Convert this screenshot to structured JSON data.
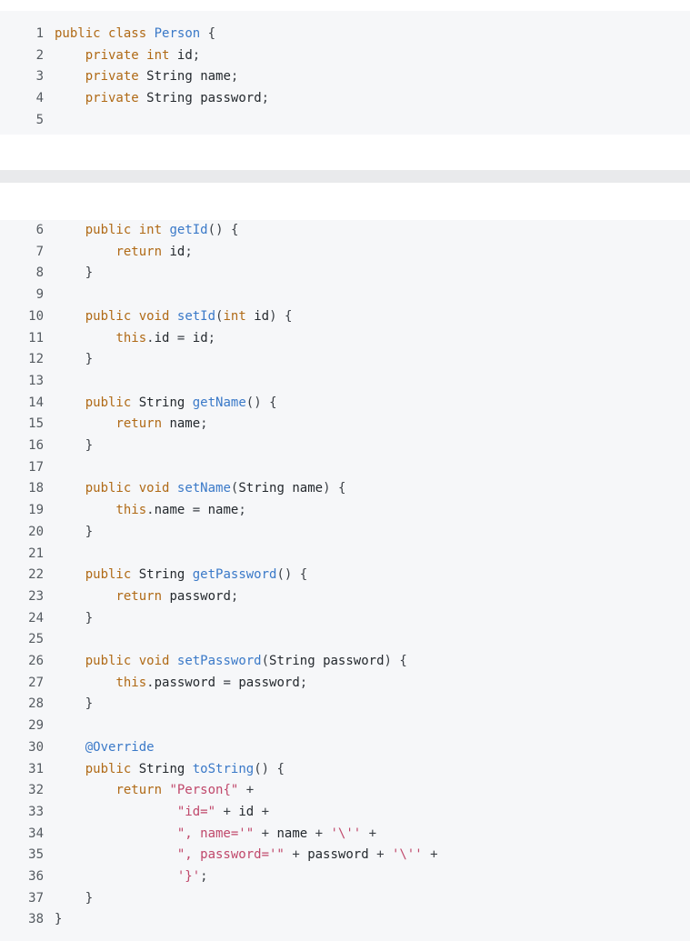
{
  "colors": {
    "background": "#f6f7f9",
    "separator": "#e9eaec",
    "line_number": "#555b61",
    "keyword": "#b06a16",
    "method": "#3a79c8",
    "string": "#c0486b",
    "text": "#24292e"
  },
  "blocks": [
    {
      "lines": [
        {
          "number": "1",
          "code": "public class Person {"
        },
        {
          "number": "2",
          "code": "    private int id;"
        },
        {
          "number": "3",
          "code": "    private String name;"
        },
        {
          "number": "4",
          "code": "    private String password;"
        },
        {
          "number": "5",
          "code": ""
        }
      ]
    },
    {
      "lines": [
        {
          "number": "6",
          "code": "    public int getId() {"
        },
        {
          "number": "7",
          "code": "        return id;"
        },
        {
          "number": "8",
          "code": "    }"
        },
        {
          "number": "9",
          "code": ""
        },
        {
          "number": "10",
          "code": "    public void setId(int id) {"
        },
        {
          "number": "11",
          "code": "        this.id = id;"
        },
        {
          "number": "12",
          "code": "    }"
        },
        {
          "number": "13",
          "code": ""
        },
        {
          "number": "14",
          "code": "    public String getName() {"
        },
        {
          "number": "15",
          "code": "        return name;"
        },
        {
          "number": "16",
          "code": "    }"
        },
        {
          "number": "17",
          "code": ""
        },
        {
          "number": "18",
          "code": "    public void setName(String name) {"
        },
        {
          "number": "19",
          "code": "        this.name = name;"
        },
        {
          "number": "20",
          "code": "    }"
        },
        {
          "number": "21",
          "code": ""
        },
        {
          "number": "22",
          "code": "    public String getPassword() {"
        },
        {
          "number": "23",
          "code": "        return password;"
        },
        {
          "number": "24",
          "code": "    }"
        },
        {
          "number": "25",
          "code": ""
        },
        {
          "number": "26",
          "code": "    public void setPassword(String password) {"
        },
        {
          "number": "27",
          "code": "        this.password = password;"
        },
        {
          "number": "28",
          "code": "    }"
        },
        {
          "number": "29",
          "code": ""
        },
        {
          "number": "30",
          "code": "    @Override"
        },
        {
          "number": "31",
          "code": "    public String toString() {"
        },
        {
          "number": "32",
          "code": "        return \"Person{\" +"
        },
        {
          "number": "33",
          "code": "                \"id=\" + id +"
        },
        {
          "number": "34",
          "code": "                \", name='\" + name + '\\'' +"
        },
        {
          "number": "35",
          "code": "                \", password='\" + password + '\\'' +"
        },
        {
          "number": "36",
          "code": "                '}';"
        },
        {
          "number": "37",
          "code": "    }"
        },
        {
          "number": "38",
          "code": "}"
        }
      ]
    }
  ]
}
